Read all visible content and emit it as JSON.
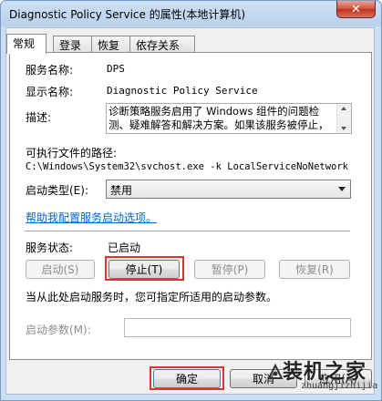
{
  "window": {
    "title": "Diagnostic Policy Service 的属性(本地计算机)",
    "close_glyph": "✕"
  },
  "tabs": [
    {
      "label": "常规",
      "active": true
    },
    {
      "label": "登录",
      "active": false
    },
    {
      "label": "恢复",
      "active": false
    },
    {
      "label": "依存关系",
      "active": false
    }
  ],
  "general": {
    "service_name_label": "服务名称:",
    "service_name_value": "DPS",
    "display_name_label": "显示名称:",
    "display_name_value": "Diagnostic Policy Service",
    "description_label": "描述:",
    "description_value": "诊断策略服务启用了 Windows 组件的问题检测、疑难解答和解决方案。如果该服务被停止，",
    "exe_path_label": "可执行文件的路径:",
    "exe_path_value": "C:\\Windows\\System32\\svchost.exe -k LocalServiceNoNetwork",
    "startup_type_label": "启动类型(E):",
    "startup_type_value": "禁用",
    "help_link": "帮助我配置服务启动选项。",
    "status_label": "服务状态:",
    "status_value": "已启动",
    "buttons": {
      "start": "启动(S)",
      "stop": "停止(T)",
      "pause": "暂停(P)",
      "resume": "恢复(R)"
    },
    "start_params_hint": "当从此处启动服务时，您可指定所适用的启动参数。",
    "start_params_label": "启动参数(M):",
    "start_params_value": ""
  },
  "footer": {
    "ok": "确定",
    "cancel": "取消",
    "apply": "应用(A)"
  },
  "watermark": {
    "line1": "装机之家",
    "line2": "zhuangjizhijia"
  },
  "colors": {
    "highlight": "#e5312b",
    "link": "#0066cc",
    "close": "#c0321c"
  }
}
